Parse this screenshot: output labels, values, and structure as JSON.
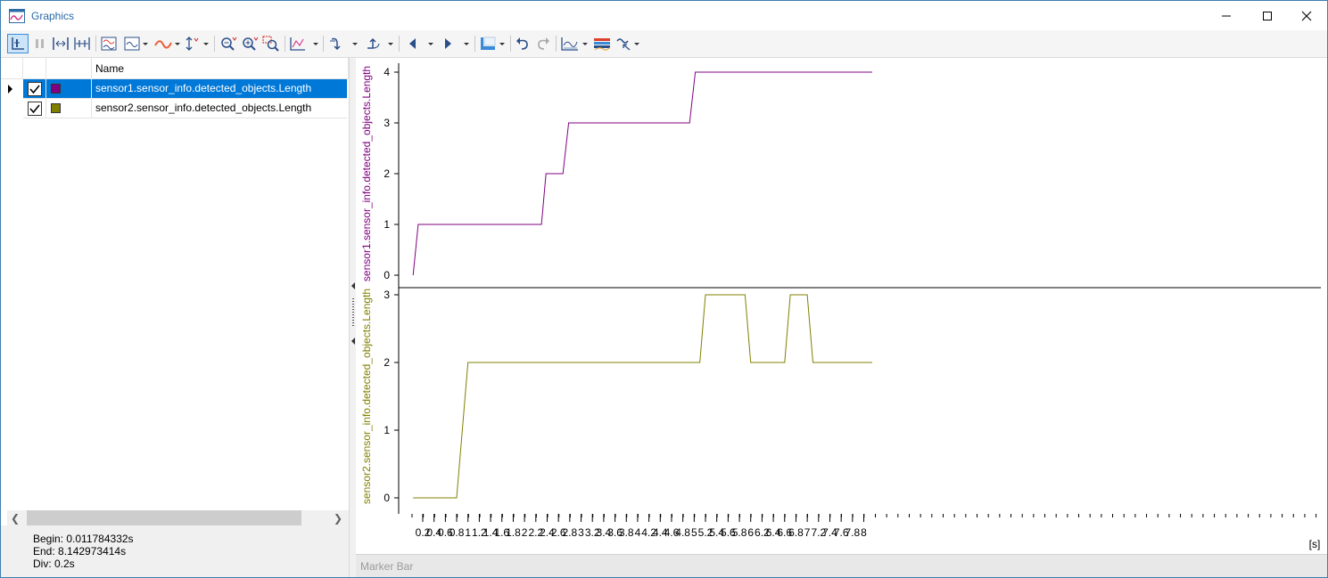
{
  "window": {
    "title": "Graphics",
    "icons": [
      "graphics-app-icon",
      "minimize-icon",
      "maximize-icon",
      "close-icon"
    ]
  },
  "toolbar": {
    "icons": [
      "cursor-mode-icon",
      "pause-icon",
      "fit-time-icon",
      "fit-time-all-icon",
      "signal-layout-icon",
      "signal-style-icon",
      "curve-icon",
      "axis-scale-icon",
      "zoom-out-icon",
      "zoom-in-icon",
      "zoom-box-icon",
      "chart-options-icon",
      "previous-step-icon",
      "next-step-icon",
      "previous-marker-icon",
      "next-marker-icon",
      "layout-icon",
      "undo-icon",
      "redo-icon",
      "chart-type-icon",
      "color-map-icon",
      "signal-export-icon"
    ]
  },
  "signal_list": {
    "header_name": "Name",
    "rows": [
      {
        "name": "sensor1.sensor_info.detected_objects.Length",
        "color": "#800080",
        "checked": true,
        "selected": true
      },
      {
        "name": "sensor2.sensor_info.detected_objects.Length",
        "color": "#808000",
        "checked": true,
        "selected": false
      }
    ]
  },
  "info": {
    "begin": "Begin: 0.011784332s",
    "end": "End: 8.142973414s",
    "div": "Div: 0.2s"
  },
  "marker_bar": {
    "label": "Marker Bar"
  },
  "chart_data": [
    {
      "type": "line",
      "ylabel": "sensor1.sensor_info.detected_objects.Length",
      "color": "#800080",
      "xlim": [
        0.012,
        8.143
      ],
      "ylim": [
        0,
        4
      ],
      "yticks": [
        0,
        1,
        2,
        3,
        4
      ],
      "x": [
        0.03,
        0.12,
        2.3,
        2.38,
        2.68,
        2.78,
        4.92,
        5.02,
        8.15
      ],
      "values": [
        0,
        1,
        1,
        2,
        2,
        3,
        3,
        4,
        4
      ]
    },
    {
      "type": "line",
      "ylabel": "sensor2.sensor_info.detected_objects.Length",
      "color": "#808000",
      "xlim": [
        0.012,
        8.143
      ],
      "ylim": [
        0,
        3
      ],
      "yticks": [
        0,
        1,
        2,
        3
      ],
      "x": [
        0.03,
        0.8,
        1.0,
        5.1,
        5.2,
        5.9,
        6.0,
        6.6,
        6.7,
        7.0,
        7.1,
        8.15
      ],
      "values": [
        0,
        0,
        2,
        2,
        3,
        3,
        2,
        2,
        3,
        3,
        2,
        2
      ]
    }
  ],
  "x_axis": {
    "unit": "[s]",
    "ticks": [
      "0.2",
      "0.4",
      "0.6",
      "0.8",
      "1",
      "1.2",
      "1.4",
      "1.6",
      "1.8",
      "2",
      "2.2",
      "2.4",
      "2.6",
      "2.8",
      "3",
      "3.2",
      "3.4",
      "3.6",
      "3.8",
      "4",
      "4.2",
      "4.4",
      "4.6",
      "4.8",
      "5",
      "5.2",
      "5.4",
      "5.6",
      "5.8",
      "6",
      "6.2",
      "6.4",
      "6.6",
      "6.8",
      "7",
      "7.2",
      "7.4",
      "7.6",
      "7.8",
      "8"
    ]
  }
}
